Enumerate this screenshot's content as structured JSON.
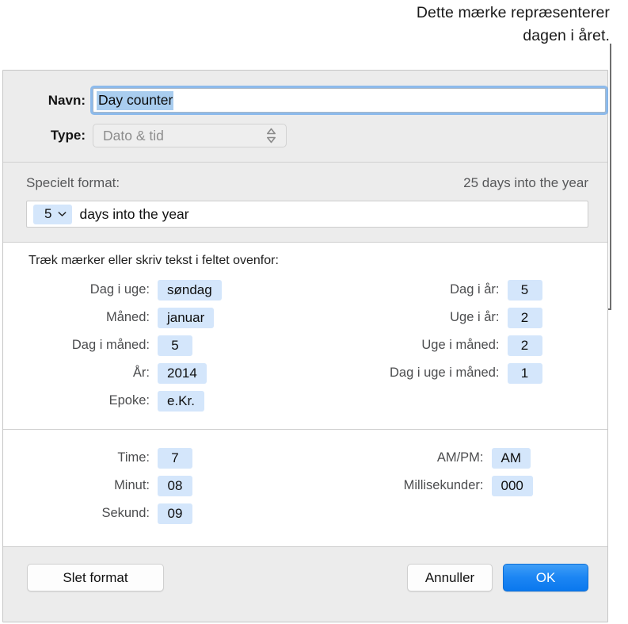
{
  "annotation": {
    "line1": "Dette mærke repræsenterer",
    "line2": "dagen i året."
  },
  "dialog": {
    "name_field": {
      "label": "Navn:",
      "value": "Day counter",
      "selected_text": "Day counter"
    },
    "type_field": {
      "label": "Type:",
      "value": "Dato & tid"
    },
    "format_section": {
      "label": "Specielt format:",
      "preview": "25 days into the year",
      "token_value": "5",
      "token_icon": "chevron-down-icon",
      "trailing_text": "days into the year"
    },
    "tokens_section": {
      "hint": "Træk mærker eller skriv tekst i feltet ovenfor:",
      "left": [
        {
          "label": "Dag i uge:",
          "value": "søndag"
        },
        {
          "label": "Måned:",
          "value": "januar"
        },
        {
          "label": "Dag i måned:",
          "value": "5"
        },
        {
          "label": "År:",
          "value": "2014"
        },
        {
          "label": "Epoke:",
          "value": "e.Kr."
        }
      ],
      "right": [
        {
          "label": "Dag i år:",
          "value": "5"
        },
        {
          "label": "Uge i år:",
          "value": "2"
        },
        {
          "label": "Uge i måned:",
          "value": "2"
        },
        {
          "label": "Dag i uge i måned:",
          "value": "1"
        }
      ]
    },
    "time_section": {
      "left": [
        {
          "label": "Time:",
          "value": "7"
        },
        {
          "label": "Minut:",
          "value": "08"
        },
        {
          "label": "Sekund:",
          "value": "09"
        }
      ],
      "right": [
        {
          "label": "AM/PM:",
          "value": "AM"
        },
        {
          "label": "Millisekunder:",
          "value": "000"
        }
      ]
    },
    "footer": {
      "delete_label": "Slet format",
      "cancel_label": "Annuller",
      "ok_label": "OK"
    }
  },
  "colors": {
    "token_blue": "#d4e6fb",
    "selection_blue": "#a9cdef",
    "accent_blue": "#1b85f3",
    "panel_grey": "#ececec",
    "callout_grey": "#6e6e6e"
  }
}
